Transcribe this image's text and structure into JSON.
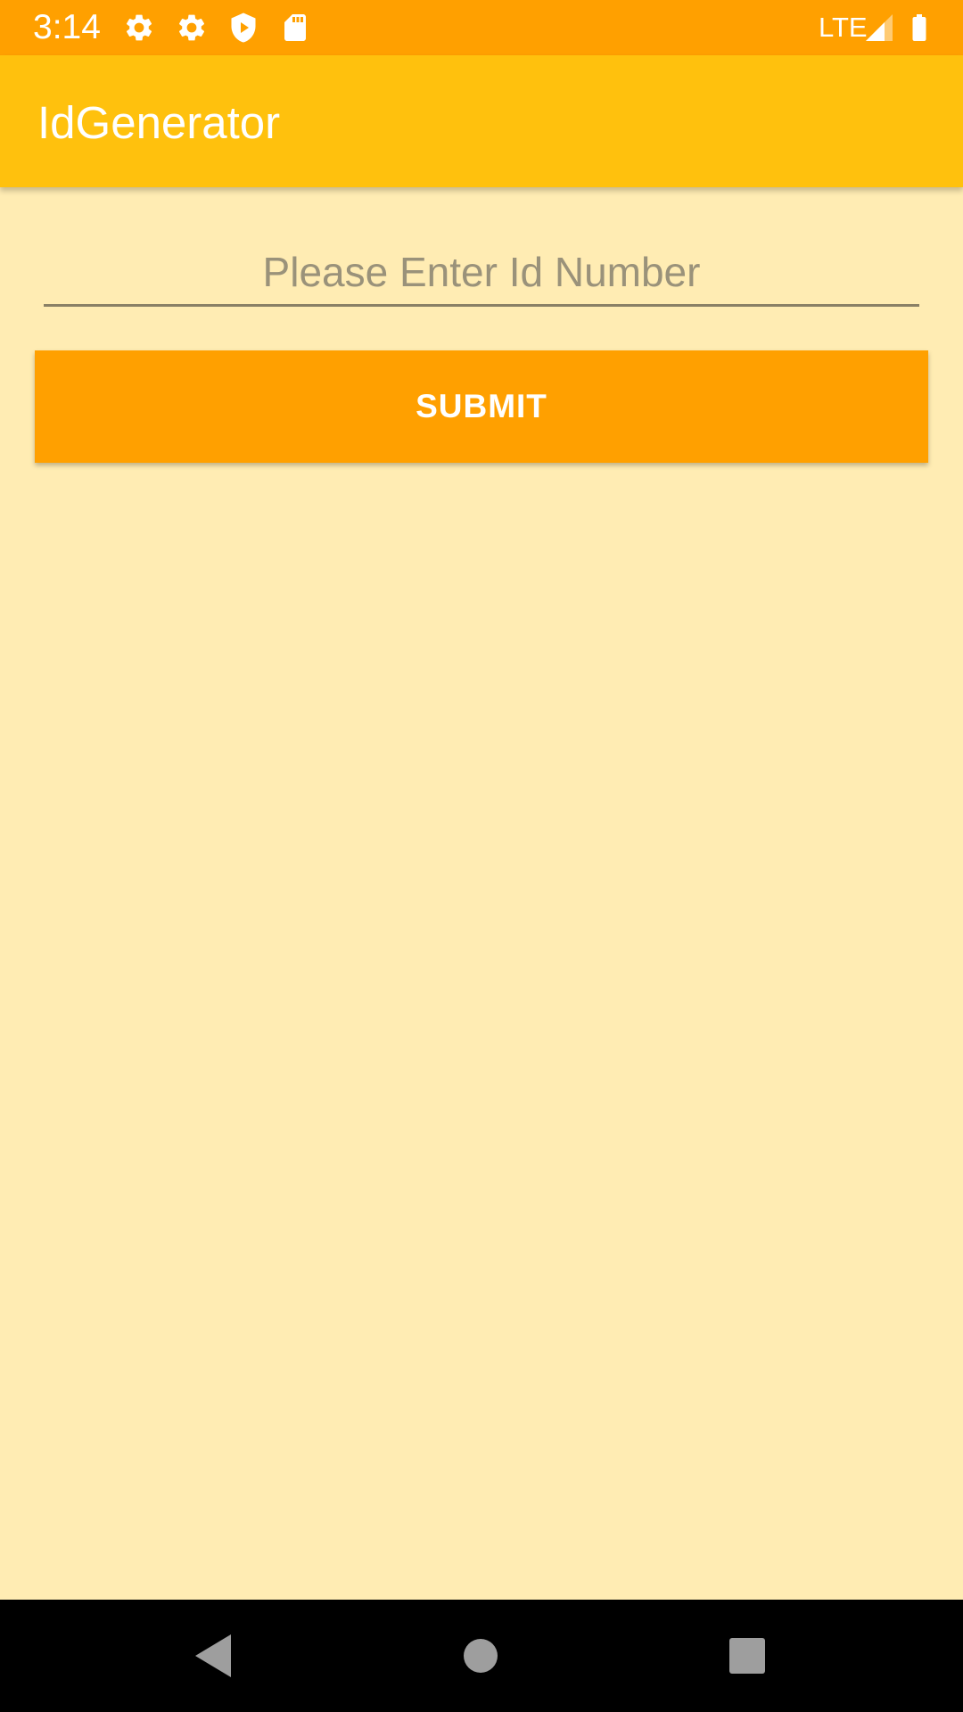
{
  "status_bar": {
    "time": "3:14",
    "network": "LTE",
    "icons": [
      "settings-icon",
      "settings-icon",
      "shield-play-icon",
      "sd-card-icon",
      "signal-icon",
      "battery-icon"
    ]
  },
  "app_bar": {
    "title": "IdGenerator"
  },
  "form": {
    "id_placeholder": "Please Enter Id Number",
    "id_value": "",
    "submit_label": "SUBMIT"
  },
  "nav_bar": {
    "icons": [
      "back-icon",
      "home-icon",
      "recents-icon"
    ]
  },
  "colors": {
    "status_bar": "#FFA000",
    "app_bar": "#FFC10D",
    "background": "#FFECB3",
    "button": "#FFA000",
    "nav_bar": "#000000"
  }
}
